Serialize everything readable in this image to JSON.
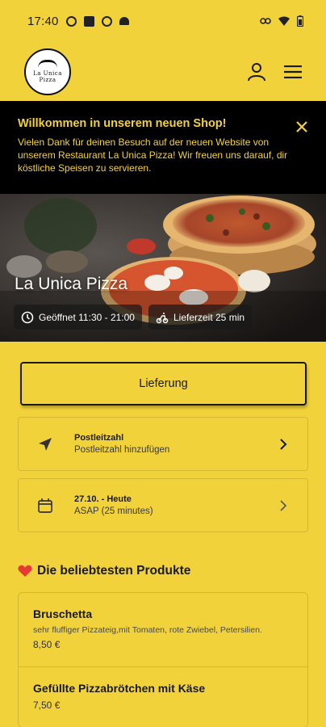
{
  "status_bar": {
    "time": "17:40"
  },
  "header": {
    "logo_lines": [
      "La Unica",
      "Pizza"
    ]
  },
  "banner": {
    "title": "Willkommen in unserem neuen Shop!",
    "text": "Vielen Dank für deinen Besuch auf der neuen Website von unserem Restaurant La Unica Pizza! Wir freuen uns darauf, dir köstliche Speisen zu servieren."
  },
  "hero": {
    "title": "La Unica Pizza",
    "hours": "Geöffnet 11:30 - 21:00",
    "delivery_time": "Lieferzeit 25 min"
  },
  "order_mode": {
    "label": "Lieferung"
  },
  "postcode": {
    "title": "Postleitzahl",
    "subtitle": "Postleitzahl hinzufügen"
  },
  "schedule": {
    "title": "27.10. - Heute",
    "subtitle": "ASAP (25 minutes)"
  },
  "popular": {
    "heading": "Die beliebtesten Produkte",
    "items": [
      {
        "name": "Bruschetta",
        "description": "sehr fluffiger Pizzateig,mit Tomaten, rote Zwiebel, Petersilien.",
        "price": "8,50 €"
      },
      {
        "name": "Gefüllte Pizzabrötchen mit Käse",
        "price": "7,50 €"
      }
    ]
  },
  "colors": {
    "background": "#F2D23A",
    "banner": "#000000",
    "heart": "#E53935"
  },
  "icons": [
    "user-icon",
    "menu-icon",
    "close-icon",
    "clock-icon",
    "scooter-icon",
    "location-arrow-icon",
    "calendar-icon",
    "chevron-right-icon",
    "heart-icon"
  ]
}
